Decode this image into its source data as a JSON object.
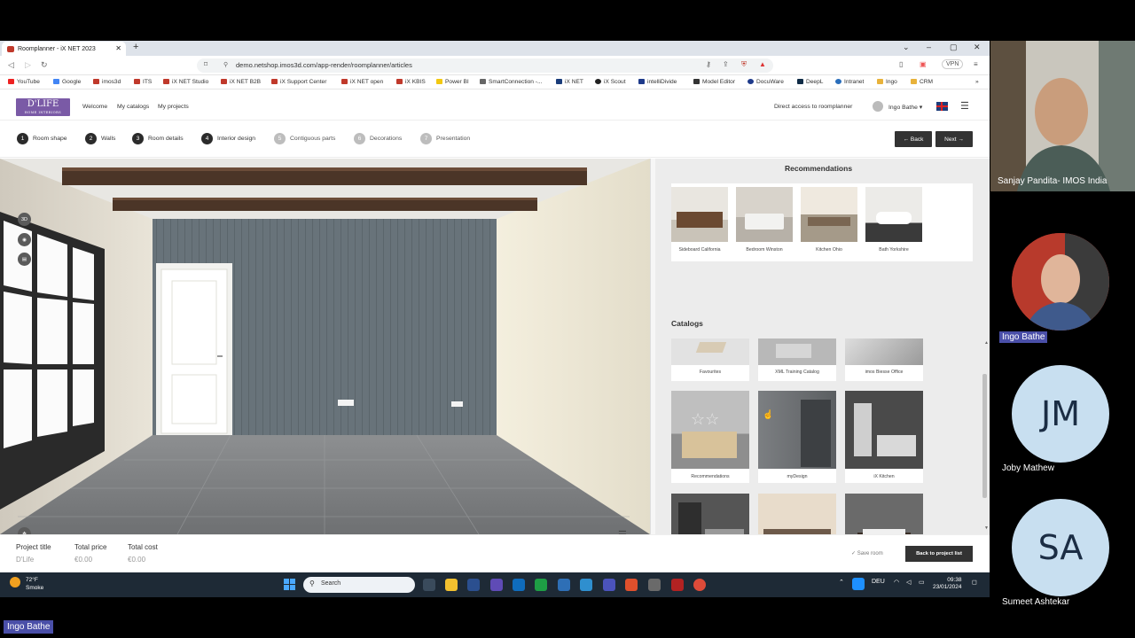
{
  "browser": {
    "tab_title": "Roomplanner - iX NET 2023",
    "url": "demo.netshop.imos3d.com/app-render/roomplanner/articles",
    "vpn_label": "VPN",
    "bookmarks": [
      "YouTube",
      "Google",
      "imos3d",
      "ITS",
      "iX NET Studio",
      "iX NET B2B",
      "iX Support Center",
      "iX NET open",
      "iX KBIS",
      "Power BI",
      "SmartConnection -...",
      "iX NET",
      "iX Scout",
      "intelliDivide",
      "Model Editor",
      "DocuWare",
      "DeepL",
      "Intranet",
      "Ingo",
      "CRM"
    ]
  },
  "app": {
    "logo_main": "D'LIFE",
    "logo_sub": "HOME INTERIORS",
    "nav": [
      "Welcome",
      "My catalogs",
      "My projects"
    ],
    "direct_access": "Direct access to roomplanner",
    "user_name": "Ingo Bathe ▾"
  },
  "steps": [
    {
      "num": "1",
      "label": "Room shape"
    },
    {
      "num": "2",
      "label": "Walls"
    },
    {
      "num": "3",
      "label": "Room details"
    },
    {
      "num": "4",
      "label": "Interior design"
    },
    {
      "num": "5",
      "label": "Contiguous parts"
    },
    {
      "num": "6",
      "label": "Decorations"
    },
    {
      "num": "7",
      "label": "Presentation"
    }
  ],
  "buttons": {
    "back": "← Back",
    "next": "Next →"
  },
  "view_tools": {
    "mode_3d": "3D"
  },
  "panel": {
    "recommendations_title": "Recommendations",
    "recommendations": [
      "Sideboard California",
      "Bedroom Winston",
      "Kitchen Ohio",
      "Bath Yorkshire"
    ],
    "catalogs_title": "Catalogs",
    "catalogs": [
      "Favourites",
      "XML Training Catalog",
      "imos Biesse Office",
      "Recommendations",
      "myDesign",
      "iX Kitchen",
      "",
      "",
      ""
    ]
  },
  "footer": {
    "project_title_label": "Project title",
    "project_title_value": "D'Life",
    "total_price_label": "Total price",
    "total_price_value": "€0.00",
    "total_cost_label": "Total cost",
    "total_cost_value": "€0.00",
    "save_room": "✓ Save room",
    "back_to_list": "Back to project list"
  },
  "taskbar": {
    "temp": "72°F",
    "weather": "Smoke",
    "search": "Search",
    "lang": "DEU",
    "time": "09:38",
    "date": "23/01/2024"
  },
  "participants": [
    {
      "name": "Sanjay Pandita- IMOS India"
    },
    {
      "name": "Ingo Bathe"
    },
    {
      "name": "Joby Mathew",
      "initials": "JM"
    },
    {
      "name": "Sumeet Ashtekar",
      "initials": "SA"
    }
  ],
  "bottom_tag": "Ingo Bathe"
}
